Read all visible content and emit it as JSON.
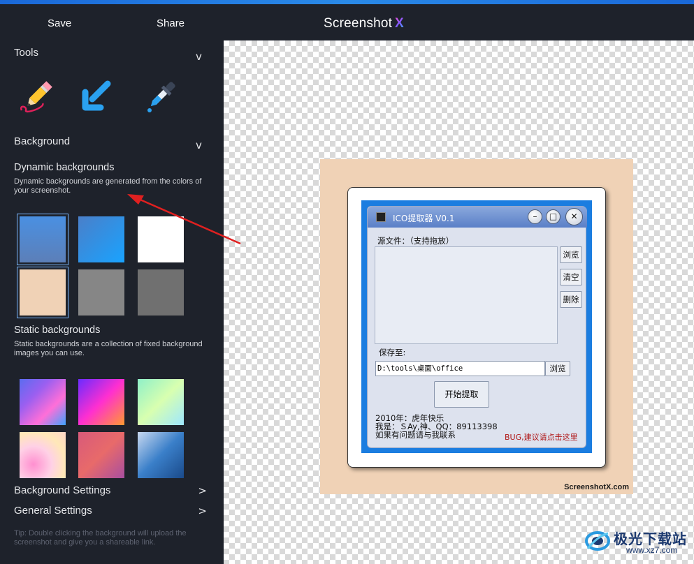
{
  "topbar": {
    "save_label": "Save",
    "share_label": "Share",
    "brand_text": "Screenshot",
    "brand_x": "X"
  },
  "sidebar": {
    "tools_title": "Tools",
    "tools_chevron": "v",
    "tools": [
      {
        "icon": "pencil-icon"
      },
      {
        "icon": "arrow-icon"
      },
      {
        "icon": "eyedropper-icon"
      }
    ],
    "background_title": "Background",
    "background_chevron": "v",
    "dynamic_title": "Dynamic backgrounds",
    "dynamic_desc": "Dynamic backgrounds are generated from the colors of your screenshot.",
    "dynamic_swatches": [
      {
        "color": "linear-gradient(180deg,#4a90e2,#5c7fb8)",
        "selected": true
      },
      {
        "color": "linear-gradient(135deg,#4a7fc9,#19a3ff)",
        "selected": false
      },
      {
        "color": "#ffffff",
        "selected": false
      },
      {
        "color": "#f0d2b6",
        "selected": true
      },
      {
        "color": "#868686",
        "selected": false
      },
      {
        "color": "#707070",
        "selected": false
      }
    ],
    "static_title": "Static backgrounds",
    "static_desc": "Static backgrounds are a collection of fixed background images you can use.",
    "static_swatches": [
      {
        "color": "linear-gradient(135deg,#5b6cf0,#9b5ff0,#ff6fd8,#3fa2ff)"
      },
      {
        "color": "linear-gradient(135deg,#6a2bff,#ff2fd0,#ff9a30)"
      },
      {
        "color": "linear-gradient(135deg,#8ff0c8,#d8ffb0,#9ee7ff)"
      },
      {
        "color": "radial-gradient(circle at 30% 70%,#ff8fd0,#ffd1e6 40%,#ffe8b8 70%,#ffd6c8)"
      },
      {
        "color": "linear-gradient(135deg,#d85a7a,#e86a6a,#a84ea0)"
      },
      {
        "color": "linear-gradient(135deg,#c8d8f0,#3a7fc9,#1a4a8a)"
      }
    ],
    "background_settings": "Background Settings",
    "general_settings": "General Settings",
    "settings_arrow": ">",
    "tip": "Tip: Double clicking the background will upload the screenshot and give you a shareable link."
  },
  "canvas": {
    "frame_color": "#f0d2b6",
    "watermark": "ScreenshotX.com",
    "app": {
      "title": "ICO提取器 V0.1",
      "min": "–",
      "max": "□",
      "close": "✕",
      "source_label": "源文件：（支持拖放）",
      "browse1": "浏览",
      "clear": "清空",
      "delete": "删除",
      "save_to_label": "保存至:",
      "path_value": "D:\\tools\\桌面\\office",
      "browse2": "浏览",
      "start_button": "开始提取",
      "line1": "2010年：虎年快乐",
      "line2": "我是：ＳAy,神、QQ：89113398",
      "line3": "如果有问题请与我联系",
      "bug_link": "BUG,建议请点击这里"
    }
  },
  "site_watermark": {
    "cn": "极光下载站",
    "url": "www.xz7.com"
  }
}
